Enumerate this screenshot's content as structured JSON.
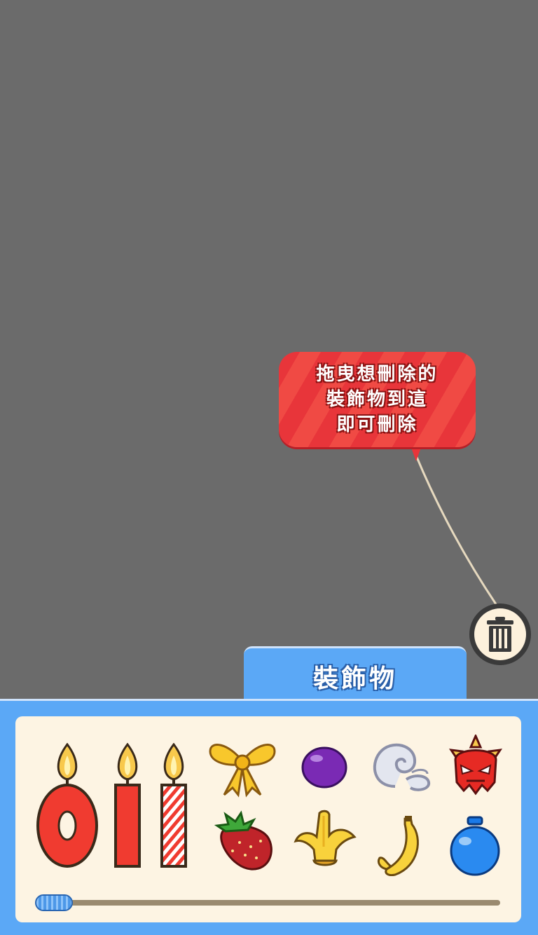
{
  "hint_bubble": {
    "line1": "拖曳想刪除的",
    "line2": "裝飾物到這",
    "line3": "即可刪除"
  },
  "panel": {
    "tab_label": "裝飾物",
    "items_row1": [
      "candle-number-0-icon",
      "candle-number-1-icon",
      "candle-striped-icon",
      "yellow-ribbon-bow-icon",
      "purple-grape-icon",
      "silver-swirl-icon",
      "red-devil-mask-icon"
    ],
    "items_row2": [
      "strawberry-icon",
      "banana-peel-icon",
      "banana-icon",
      "blue-balloon-icon"
    ],
    "scroll_position": 0.0
  },
  "colors": {
    "background": "#6b6b6b",
    "panel_blue": "#5ba8f6",
    "bubble_red": "#e8353a",
    "panel_cream": "#fdf4e3"
  }
}
